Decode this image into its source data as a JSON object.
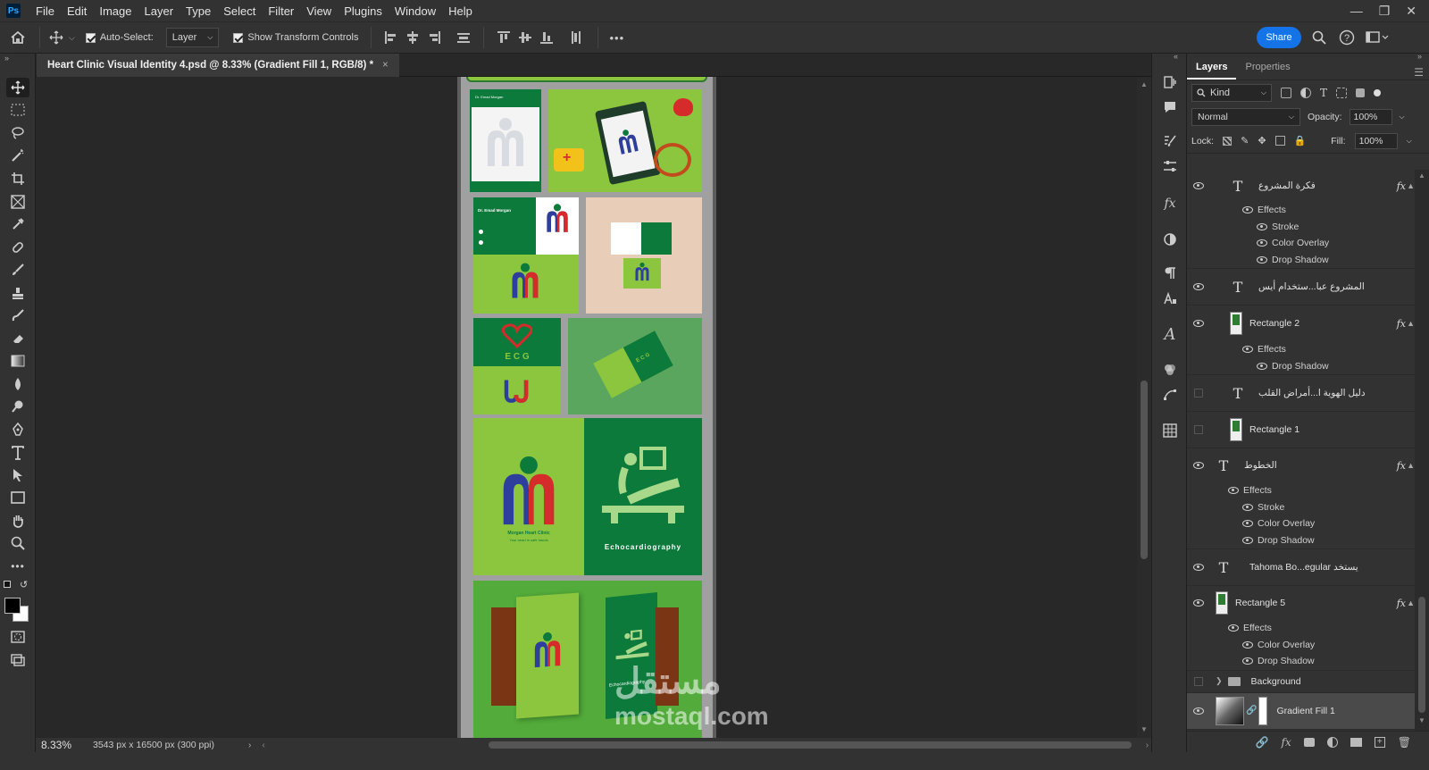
{
  "menu": [
    "File",
    "Edit",
    "Image",
    "Layer",
    "Type",
    "Select",
    "Filter",
    "View",
    "Plugins",
    "Window",
    "Help"
  ],
  "app_badge": "Ps",
  "options": {
    "auto_select_label": "Auto-Select:",
    "auto_select_value": "Layer",
    "transform_label": "Show Transform Controls",
    "more": "•••",
    "share_label": "Share"
  },
  "doc": {
    "tab_title": "Heart Clinic Visual Identity 4.psd @ 8.33% (Gradient Fill 1, RGB/8) *",
    "close": "×"
  },
  "status": {
    "zoom": "8.33%",
    "info": "3543 px x 16500 px (300 ppi)"
  },
  "canvas_text": {
    "ecg": "E C G",
    "clinic_name": "Morgan Heart Clinic",
    "clinic_tagline": "Your heart in safe hands",
    "echo": "Echocardiography",
    "card_name": "Dr. Emad Morgan",
    "watermark_ar": "مستقل",
    "watermark_en": "mostaql.com"
  },
  "panel": {
    "tabs": [
      "Layers",
      "Properties"
    ],
    "kind_label": "Kind",
    "blend_mode": "Normal",
    "opacity_label": "Opacity:",
    "opacity_value": "100%",
    "lock_label": "Lock:",
    "fill_label": "Fill:",
    "fill_value": "100%",
    "effects_label": "Effects",
    "fx": "fx"
  },
  "layers": [
    {
      "name": "فكرة المشروع",
      "type": "text",
      "visible": true,
      "fx": true,
      "effects": [
        "Stroke",
        "Color Overlay",
        "Drop Shadow"
      ]
    },
    {
      "name": "المشروع عبا...ستخدام أيس",
      "type": "text",
      "visible": true,
      "fx": false,
      "effects": []
    },
    {
      "name": "Rectangle 2",
      "type": "shape",
      "visible": true,
      "fx": true,
      "effects": [
        "Drop Shadow"
      ]
    },
    {
      "name": "دليل الهوية ا...أمراض القلب",
      "type": "text",
      "visible": false,
      "fx": false,
      "effects": []
    },
    {
      "name": "Rectangle 1",
      "type": "shape",
      "visible": false,
      "fx": false,
      "effects": []
    },
    {
      "name": "الخطوط",
      "type": "text",
      "visible": true,
      "fx": true,
      "effects": [
        "Stroke",
        "Color Overlay",
        "Drop Shadow"
      ]
    },
    {
      "name": "Tahoma Bo...egular يستخد",
      "type": "text",
      "visible": true,
      "fx": false,
      "effects": []
    },
    {
      "name": "Rectangle 5",
      "type": "shape",
      "visible": true,
      "fx": true,
      "effects": [
        "Color Overlay",
        "Drop Shadow"
      ]
    },
    {
      "name": "Background",
      "type": "group",
      "visible": false,
      "fx": false,
      "effects": []
    },
    {
      "name": "Gradient Fill 1",
      "type": "fill",
      "visible": true,
      "fx": false,
      "effects": [],
      "selected": true
    }
  ],
  "colors": {
    "accent": "#1473e6",
    "light_green": "#8cc63f",
    "dark_green": "#0b7a3b",
    "panel_bg": "#323232"
  }
}
